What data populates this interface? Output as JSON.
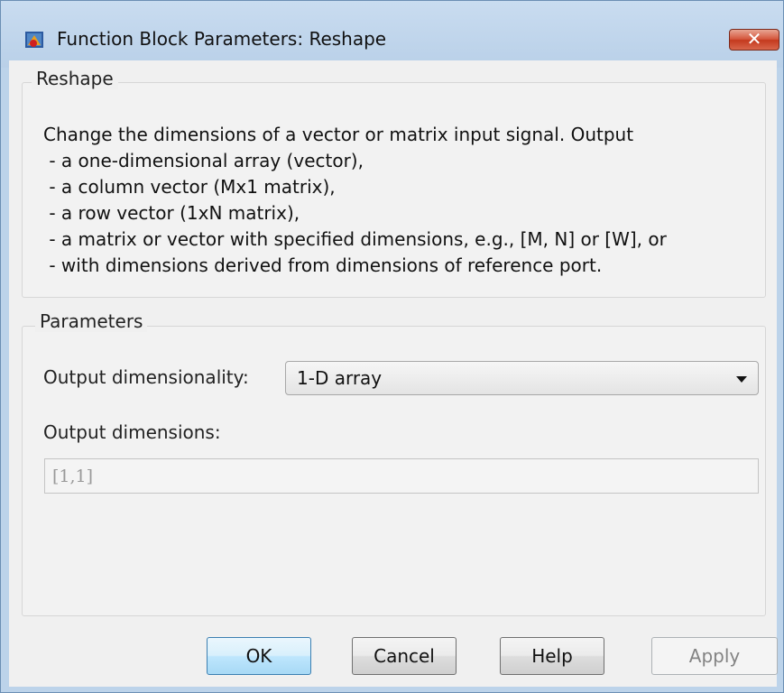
{
  "window": {
    "title": "Function Block Parameters: Reshape",
    "close_label": "✕"
  },
  "description_group": {
    "title": "Reshape",
    "text": "Change the dimensions of a vector or matrix input signal. Output\n - a one-dimensional array (vector),\n - a column vector (Mx1 matrix),\n - a row vector (1xN matrix),\n - a matrix or vector with specified dimensions, e.g., [M, N] or [W], or\n - with dimensions derived from dimensions of reference port."
  },
  "parameters_group": {
    "title": "Parameters",
    "output_dimensionality_label": "Output dimensionality:",
    "output_dimensionality_value": "1-D array",
    "output_dimensions_label": "Output dimensions:",
    "output_dimensions_value": "[1,1]"
  },
  "buttons": {
    "ok": "OK",
    "cancel": "Cancel",
    "help": "Help",
    "apply": "Apply"
  }
}
